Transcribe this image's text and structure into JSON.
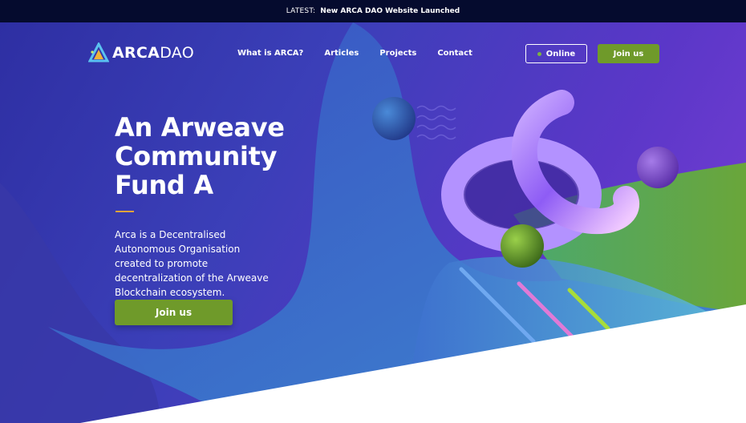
{
  "banner": {
    "prefix": "LATEST:",
    "headline": "New ARCA DAO Website Launched"
  },
  "brand": {
    "name_bold": "ARCA",
    "name_light": "DAO",
    "logo_icon": "arca-triangle-logo-icon"
  },
  "nav": {
    "items": [
      {
        "label": "What is ARCA?"
      },
      {
        "label": "Articles"
      },
      {
        "label": "Projects"
      },
      {
        "label": "Contact"
      }
    ]
  },
  "header_buttons": {
    "online_label": "Online",
    "join_label": "Join us"
  },
  "hero": {
    "title": "An Arweave Community Fund A",
    "description": "Arca is a Decentralised Autonomous Organisation created to promote decentralization of the Arweave Blockchain ecosystem.",
    "cta_label": "Join us"
  },
  "colors": {
    "banner_bg": "#050b2e",
    "hero_primary": "#3b3fb8",
    "hero_secondary": "#7b3fd6",
    "accent_green": "#6f9a2a",
    "accent_orange": "#e8a33a",
    "status_dot": "#7cb342"
  }
}
